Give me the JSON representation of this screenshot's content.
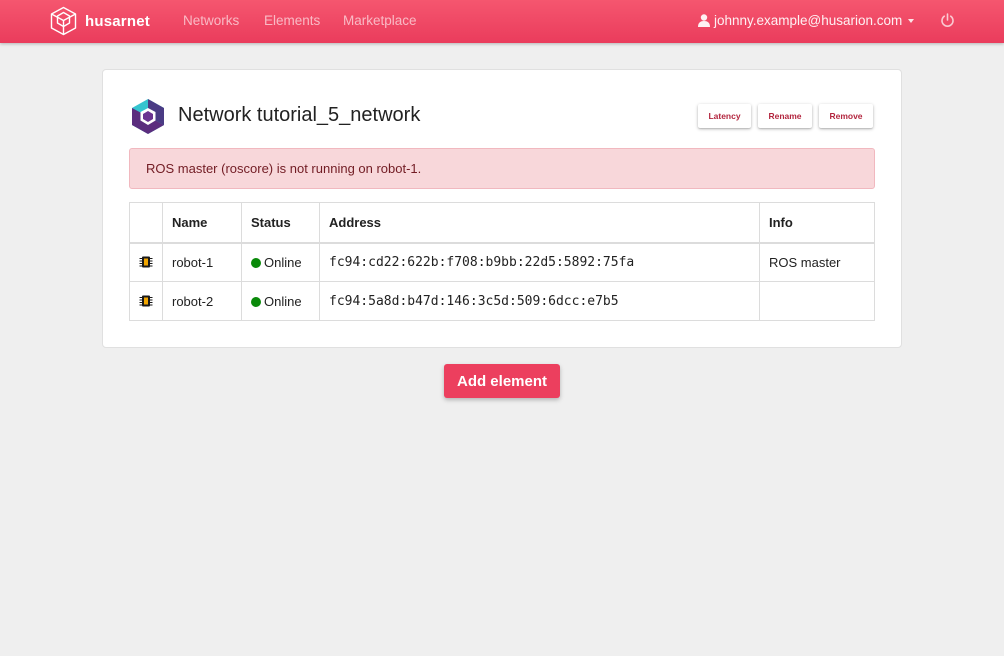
{
  "navbar": {
    "brand": "husarnet",
    "links": [
      "Networks",
      "Elements",
      "Marketplace"
    ],
    "user_email": "johnny.example@husarion.com"
  },
  "network": {
    "title": "Network tutorial_5_network",
    "actions": {
      "latency": "Latency",
      "rename": "Rename",
      "remove": "Remove"
    },
    "alert": "ROS master (roscore) is not running on robot-1."
  },
  "table": {
    "headers": {
      "name": "Name",
      "status": "Status",
      "address": "Address",
      "info": "Info"
    },
    "rows": [
      {
        "name": "robot-1",
        "status": "Online",
        "address": "fc94:cd22:622b:f708:b9bb:22d5:5892:75fa",
        "info": "ROS master"
      },
      {
        "name": "robot-2",
        "status": "Online",
        "address": "fc94:5a8d:b47d:146:3c5d:509:6dcc:e7b5",
        "info": ""
      }
    ]
  },
  "add_element_label": "Add element",
  "colors": {
    "brand": "#ec3f5e",
    "online": "#0a8a0a",
    "alert_bg": "#f8d7da",
    "alert_text": "#721c24"
  },
  "icons": {
    "brand": "husarnet-cube-logo-icon",
    "network": "network-hexagon-icon",
    "user": "user-icon",
    "power": "power-icon",
    "device": "chip-icon"
  }
}
